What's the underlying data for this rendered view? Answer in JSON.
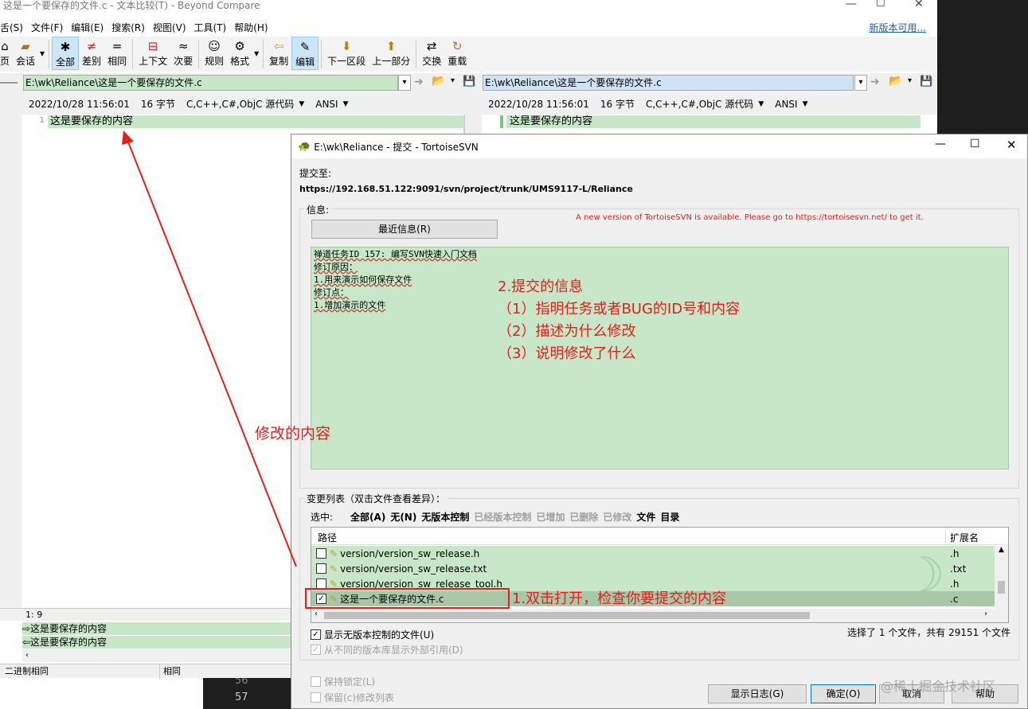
{
  "bc": {
    "title": "这是一个要保存的文件.c - 文本比较(T) - Beyond Compare",
    "menu": [
      "舌(S)",
      "文件(F)",
      "编辑(E)",
      "搜索(R)",
      "视图(V)",
      "工具(T)",
      "帮助(H)"
    ],
    "new_version": "新版本可用...",
    "toolbar": [
      "页",
      "会话",
      "全部",
      "差别",
      "相同",
      "上下文",
      "次要",
      "规则",
      "格式",
      "复制",
      "编辑",
      "下一区段",
      "上一部分",
      "交换",
      "重载"
    ],
    "left_path": "E:\\wk\\Reliance\\这是一个要保存的文件.c",
    "right_path": "E:\\wk\\Reliance\\这是一个要保存的文件.c",
    "date": "2022/10/28 11:56:01",
    "size": "16 字节",
    "lang": "C,C++,C#,ObjC 源代码",
    "encoding": "ANSI",
    "line_no": "1",
    "line_text": "这是要保存的内容",
    "cursor": "1: 9",
    "bottom_line1": "⇨这是要保存的内容",
    "bottom_line2": "⇦这是要保存的内容",
    "status_left": "二进制相同",
    "status_right": "相同",
    "editor_lines": [
      "56",
      "57"
    ]
  },
  "dlg": {
    "title": "E:\\wk\\Reliance - 提交 - TortoiseSVN",
    "commit_to_label": "提交至:",
    "url": "https://192.168.51.122:9091/svn/project/trunk/UMS9117-L/Reliance",
    "message_label": "信息:",
    "recent_btn": "最近信息(R)",
    "notice": "A new version of TortoiseSVN is available. Please go to https://tortoisesvn.net/ to get it.",
    "message_lines": [
      "禅道任务ID 157: 编写SVN快速入门文档",
      "修订原因：",
      "1.用来演示如何保存文件",
      "修订点：",
      "1.增加演示的文件"
    ],
    "changes_label": "变更列表（双击文件查看差异）：",
    "select_label": "选中:",
    "select_active": [
      "全部(A)",
      "无(N)",
      "无版本控制"
    ],
    "select_inactive": [
      "已经版本控制",
      "已增加",
      "已删除",
      "已修改"
    ],
    "select_bold": [
      "文件",
      "目录"
    ],
    "col_path": "路径",
    "col_ext": "扩展名",
    "files": [
      {
        "path": "version/version_sw_release.h",
        "ext": ".h",
        "checked": false
      },
      {
        "path": "version/version_sw_release.txt",
        "ext": ".txt",
        "checked": false
      },
      {
        "path": "version/version_sw_release_tool.h",
        "ext": ".h",
        "checked": false
      },
      {
        "path": "这是一个要保存的文件.c",
        "ext": ".c",
        "checked": true
      }
    ],
    "show_unversioned": "显示无版本控制的文件(U)",
    "show_externals": "从不同的版本库显示外部引用(D)",
    "selection_status": "选择了 1 个文件，共有 29151 个文件",
    "keep_locks": "保持锁定(L)",
    "keep_changelist": "保留(c)修改列表",
    "btn_log": "显示日志(G)",
    "btn_ok": "确定(O)",
    "btn_cancel": "取消",
    "btn_help": "帮助"
  },
  "annotations": {
    "modified": "修改的内容",
    "info_title": "2.提交的信息",
    "info_1": "（1）指明任务或者BUG的ID号和内容",
    "info_2": "（2）描述为什么修改",
    "info_3": "（3）说明修改了什么",
    "step1": "1.双击打开，检查你要提交的内容"
  },
  "watermark": "@稀土掘金技术社区"
}
